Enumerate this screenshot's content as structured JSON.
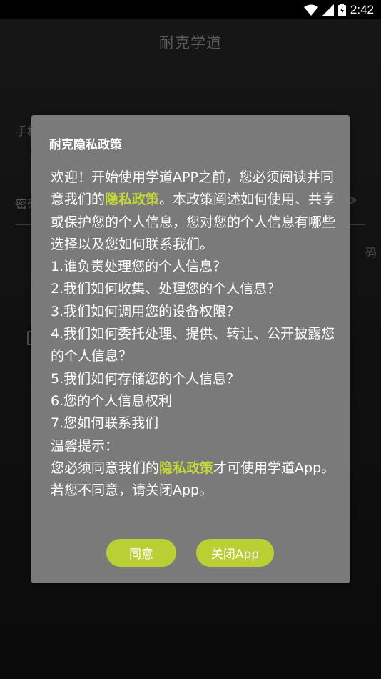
{
  "status_bar": {
    "time": "2:42",
    "icons": [
      "wifi-icon",
      "signal-icon",
      "battery-charging-icon"
    ]
  },
  "app": {
    "title": "耐克学道",
    "phone_label": "手机",
    "password_label": "密码",
    "right_hint": "码"
  },
  "dialog": {
    "title": "耐克隐私政策",
    "intro": {
      "before": "欢迎！开始使用学道APP之前，您必须阅读并同意我们的",
      "link": "隐私政策",
      "after": "。本政策阐述如何使用、共享或保护您的个人信息，您对您的个人信息有哪些选择以及您如何联系我们。"
    },
    "items": [
      "1.谁负责处理您的个人信息？",
      "2.我们如何收集、处理您的个人信息？",
      "3.我们如何调用您的设备权限？",
      "4.我们如何委托处理、提供、转让、公开披露您的个人信息？",
      "5.我们如何存储您的个人信息？",
      "6.您的个人信息权利",
      "7.您如何联系我们"
    ],
    "tip_heading": "温馨提示：",
    "tip": {
      "before": "您必须同意我们的",
      "link": "隐私政策",
      "after": "才可使用学道App。若您不同意，请关闭App。"
    },
    "agree_label": "同意",
    "close_label": "关闭App"
  },
  "colors": {
    "dialog_bg": "#7a7a7a",
    "accent": "#b9cf34",
    "highlight_text": "#c4d83a",
    "background": "#1c1c1c"
  }
}
